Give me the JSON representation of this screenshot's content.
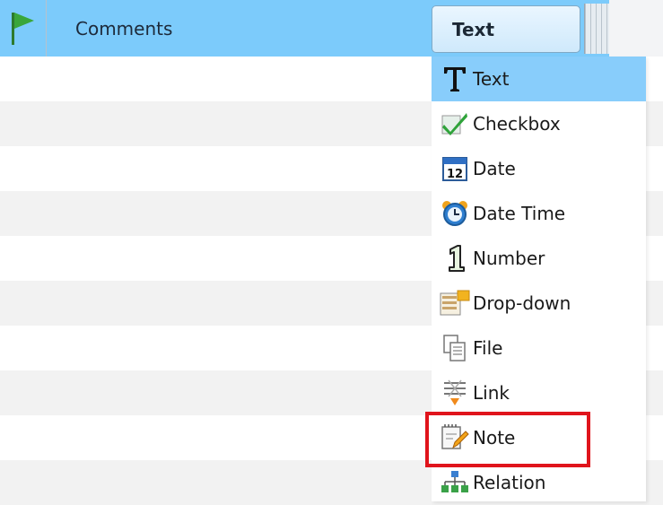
{
  "header": {
    "column_label": "Comments",
    "type_button_label": "Text"
  },
  "dropdown": {
    "selected": "Text",
    "items": [
      {
        "label": "Text",
        "icon": "text-type-icon"
      },
      {
        "label": "Checkbox",
        "icon": "checkmark-icon"
      },
      {
        "label": "Date",
        "icon": "calendar-icon"
      },
      {
        "label": "Date Time",
        "icon": "alarm-clock-icon"
      },
      {
        "label": "Number",
        "icon": "number-one-icon"
      },
      {
        "label": "Drop-down",
        "icon": "dropdown-list-icon"
      },
      {
        "label": "File",
        "icon": "file-copy-icon"
      },
      {
        "label": "Link",
        "icon": "link-icon"
      },
      {
        "label": "Note",
        "icon": "note-pencil-icon"
      },
      {
        "label": "Relation",
        "icon": "hierarchy-icon"
      }
    ],
    "calendar_day": "12"
  },
  "colors": {
    "header_bg": "#7ccbfb",
    "selected_bg": "#88cdfb",
    "highlight": "#e0141c"
  }
}
